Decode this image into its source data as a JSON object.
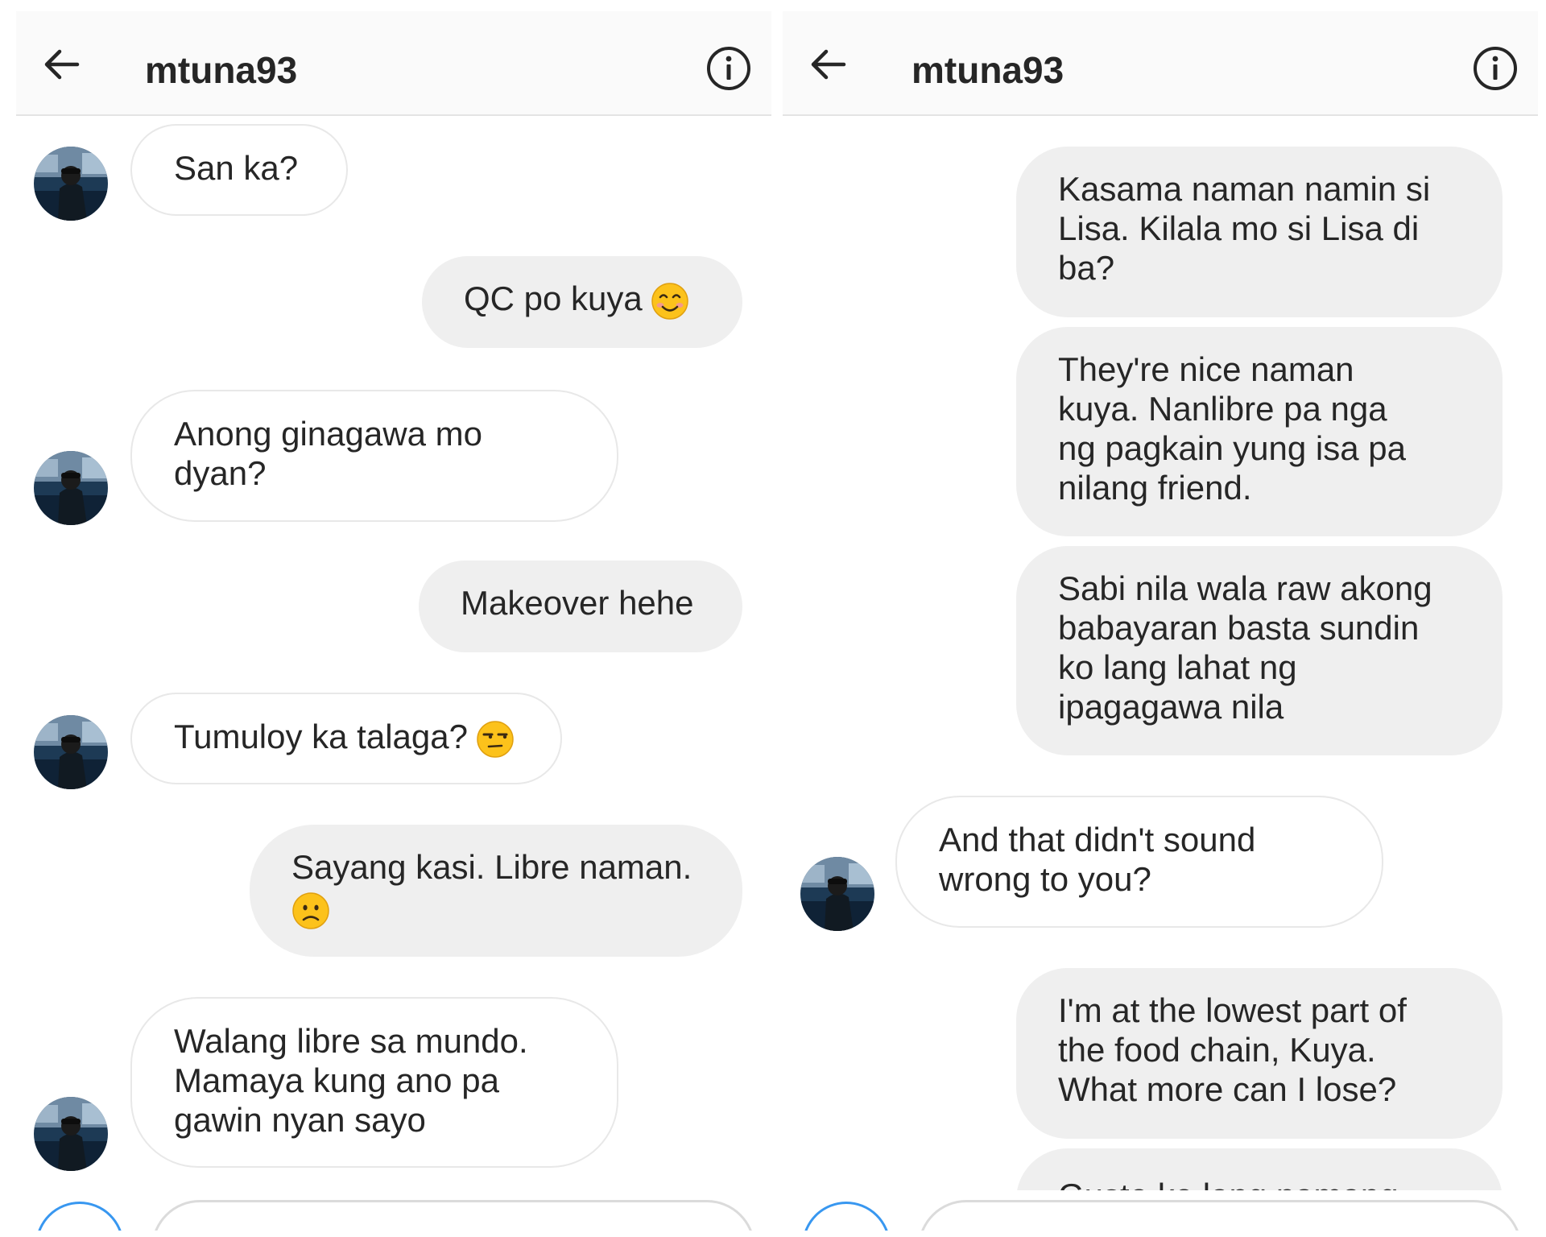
{
  "left_panel": {
    "header": {
      "username": "mtuna93"
    },
    "messages": [
      {
        "side": "incoming",
        "text": "San ka?"
      },
      {
        "side": "outgoing",
        "text": "QC po kuya",
        "emoji": "smiling-face-icon"
      },
      {
        "side": "incoming",
        "text": "Anong ginagawa mo dyan?"
      },
      {
        "side": "outgoing",
        "text": "Makeover hehe"
      },
      {
        "side": "incoming",
        "text": "Tumuloy ka talaga?",
        "emoji": "unamused-face-icon"
      },
      {
        "side": "outgoing",
        "text": "Sayang kasi. Libre naman.",
        "emoji": "frowning-face-icon"
      },
      {
        "side": "incoming",
        "text": "Walang libre sa mundo. Mamaya kung ano pa gawin nyan sayo"
      }
    ]
  },
  "right_panel": {
    "header": {
      "username": "mtuna93"
    },
    "messages": [
      {
        "side": "outgoing",
        "text": "Kasama naman namin si Lisa. Kilala mo si Lisa di ba?"
      },
      {
        "side": "outgoing",
        "text": "They're nice naman kuya. Nanlibre pa nga ng pagkain yung isa pa nilang friend."
      },
      {
        "side": "outgoing",
        "text": "Sabi nila wala raw akong babayaran basta sundin ko lang lahat ng ipagagawa nila"
      },
      {
        "side": "incoming",
        "text": "And that didn't sound wrong to you?"
      },
      {
        "side": "outgoing",
        "text": "I'm at the lowest part of the food chain, Kuya. What more can I lose?"
      },
      {
        "side": "outgoing",
        "text": "Gusto ko lang namang"
      }
    ]
  },
  "colors": {
    "header_bg": "#fafafa",
    "outgoing_bubble": "#efefef",
    "incoming_border": "#e8e8e8",
    "camera_accent": "#3897f0"
  }
}
